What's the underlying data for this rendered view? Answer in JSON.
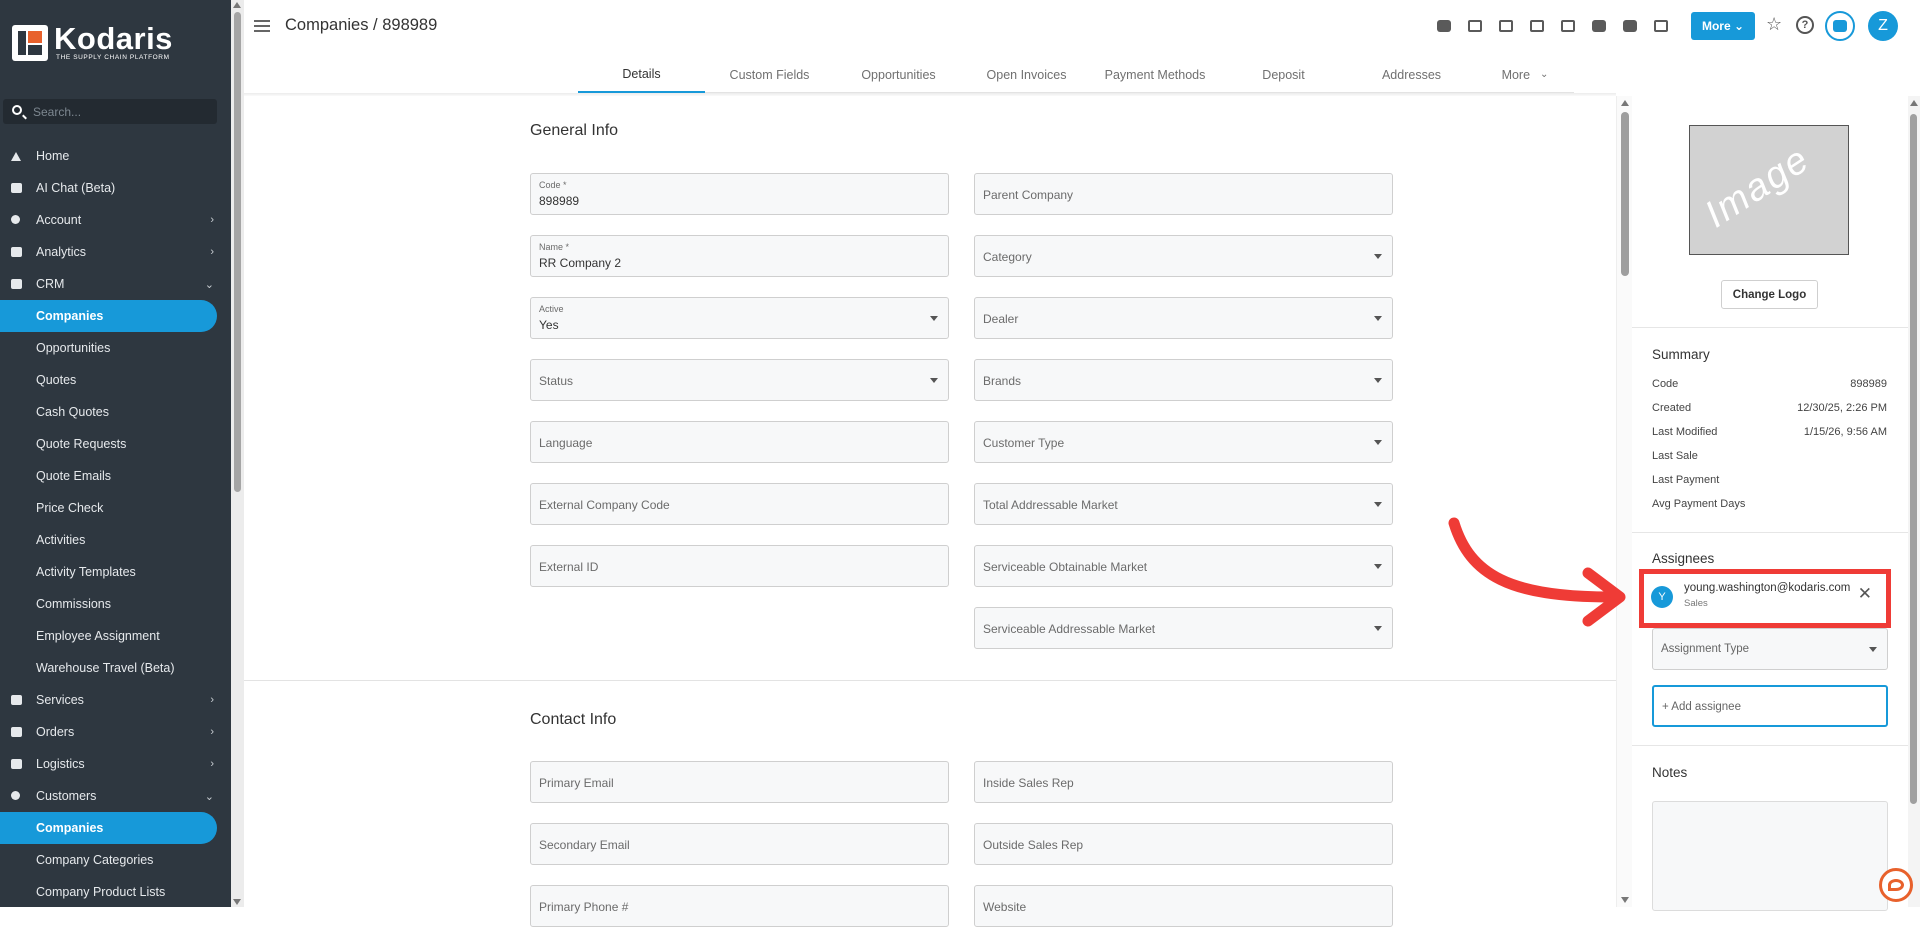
{
  "brand": {
    "name": "Kodaris",
    "tagline": "THE SUPPLY CHAIN PLATFORM",
    "accent": "#1799d9",
    "logo_accent": "#e8612c"
  },
  "sidebar": {
    "search_placeholder": "Search...",
    "items": [
      {
        "label": "Home",
        "icon": "home-icon",
        "chevron": ""
      },
      {
        "label": "AI Chat (Beta)",
        "icon": "robot-icon",
        "chevron": ""
      },
      {
        "label": "Account",
        "icon": "user-icon",
        "chevron": "›"
      },
      {
        "label": "Analytics",
        "icon": "chart-icon",
        "chevron": "›"
      },
      {
        "label": "CRM",
        "icon": "crm-icon",
        "chevron": "⌄"
      },
      {
        "label": "Companies",
        "icon": "",
        "chevron": "",
        "active": true
      },
      {
        "label": "Opportunities",
        "icon": "",
        "chevron": ""
      },
      {
        "label": "Quotes",
        "icon": "",
        "chevron": ""
      },
      {
        "label": "Cash Quotes",
        "icon": "",
        "chevron": ""
      },
      {
        "label": "Quote Requests",
        "icon": "",
        "chevron": ""
      },
      {
        "label": "Quote Emails",
        "icon": "",
        "chevron": ""
      },
      {
        "label": "Price Check",
        "icon": "",
        "chevron": ""
      },
      {
        "label": "Activities",
        "icon": "",
        "chevron": ""
      },
      {
        "label": "Activity Templates",
        "icon": "",
        "chevron": ""
      },
      {
        "label": "Commissions",
        "icon": "",
        "chevron": ""
      },
      {
        "label": "Employee Assignment",
        "icon": "",
        "chevron": ""
      },
      {
        "label": "Warehouse Travel (Beta)",
        "icon": "",
        "chevron": ""
      },
      {
        "label": "Services",
        "icon": "services-icon",
        "chevron": "›"
      },
      {
        "label": "Orders",
        "icon": "truck-icon",
        "chevron": "›"
      },
      {
        "label": "Logistics",
        "icon": "logistics-icon",
        "chevron": "›"
      },
      {
        "label": "Customers",
        "icon": "people-icon",
        "chevron": "⌄"
      },
      {
        "label": "Companies",
        "icon": "",
        "chevron": "",
        "active": true
      },
      {
        "label": "Company Categories",
        "icon": "",
        "chevron": ""
      },
      {
        "label": "Company Product Lists",
        "icon": "",
        "chevron": ""
      }
    ]
  },
  "header": {
    "title": "Companies / 898989",
    "more_label": "More ⌄",
    "avatar_initial": "Z",
    "icons": [
      "cloud-icon",
      "mail-icon",
      "card-icon",
      "inbox-icon",
      "monitor-icon",
      "person-add-icon",
      "file-icon",
      "paperclip-icon"
    ]
  },
  "tabs": [
    {
      "label": "Details",
      "active": true
    },
    {
      "label": "Custom Fields"
    },
    {
      "label": "Opportunities"
    },
    {
      "label": "Open Invoices"
    },
    {
      "label": "Payment Methods"
    },
    {
      "label": "Deposit"
    },
    {
      "label": "Addresses"
    },
    {
      "label": "More"
    }
  ],
  "general_info": {
    "title": "General Info",
    "left": [
      {
        "label": "Code *",
        "value": "898989"
      },
      {
        "label": "Name *",
        "value": "RR Company 2"
      },
      {
        "label": "Active",
        "value": "Yes",
        "select": true
      },
      {
        "placeholder": "Status",
        "select": true
      },
      {
        "placeholder": "Language"
      },
      {
        "placeholder": "External Company Code"
      },
      {
        "placeholder": "External ID"
      }
    ],
    "right": [
      {
        "placeholder": "Parent Company"
      },
      {
        "placeholder": "Category",
        "select": true
      },
      {
        "placeholder": "Dealer",
        "select": true
      },
      {
        "placeholder": "Brands",
        "select": true
      },
      {
        "placeholder": "Customer Type",
        "select": true
      },
      {
        "placeholder": "Total Addressable Market",
        "select": true
      },
      {
        "placeholder": "Serviceable Obtainable Market",
        "select": true
      },
      {
        "placeholder": "Serviceable Addressable Market",
        "select": true
      }
    ]
  },
  "contact_info": {
    "title": "Contact Info",
    "left": [
      "Primary Email",
      "Secondary Email",
      "Primary Phone #"
    ],
    "right": [
      "Inside Sales Rep",
      "Outside Sales Rep",
      "Website"
    ]
  },
  "right_panel": {
    "image_placeholder": "Image",
    "change_logo": "Change Logo",
    "summary_title": "Summary",
    "summary": [
      {
        "k": "Code",
        "v": "898989"
      },
      {
        "k": "Created",
        "v": "12/30/25, 2:26 PM"
      },
      {
        "k": "Last Modified",
        "v": "1/15/26, 9:56 AM"
      },
      {
        "k": "Last Sale",
        "v": ""
      },
      {
        "k": "Last Payment",
        "v": ""
      },
      {
        "k": "Avg Payment Days",
        "v": ""
      }
    ],
    "assignees_title": "Assignees",
    "assignee": {
      "initial": "Y",
      "email": "young.washington@kodaris.com",
      "role": "Sales"
    },
    "assignment_type_placeholder": "Assignment Type",
    "add_assignee_placeholder": "+ Add assignee",
    "notes_title": "Notes"
  }
}
